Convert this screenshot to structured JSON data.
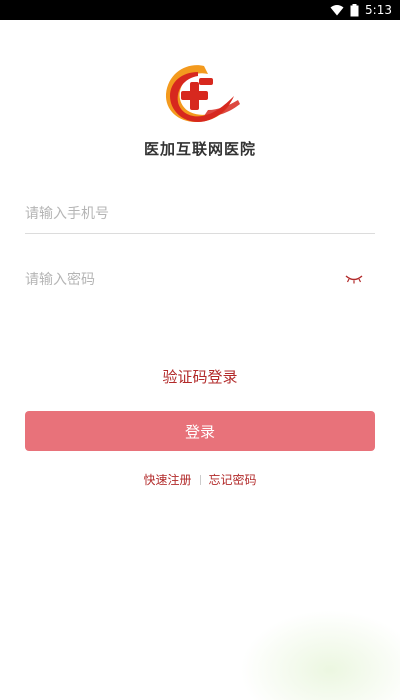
{
  "status_bar": {
    "time": "5:13",
    "wifi_icon": "wifi-icon",
    "battery_icon": "battery-icon"
  },
  "app": {
    "name": "医加互联网医院",
    "logo_icon": "hospital-cross-logo-icon"
  },
  "form": {
    "phone": {
      "placeholder": "请输入手机号",
      "value": ""
    },
    "password": {
      "placeholder": "请输入密码",
      "value": "",
      "toggle_icon": "eye-closed-icon"
    }
  },
  "actions": {
    "code_login_label": "验证码登录",
    "login_label": "登录",
    "register_label": "快速注册",
    "forgot_label": "忘记密码"
  },
  "colors": {
    "accent": "#b22a2a",
    "button": "#e8727a",
    "logo_red": "#d7281e",
    "logo_orange": "#f39a1e"
  }
}
